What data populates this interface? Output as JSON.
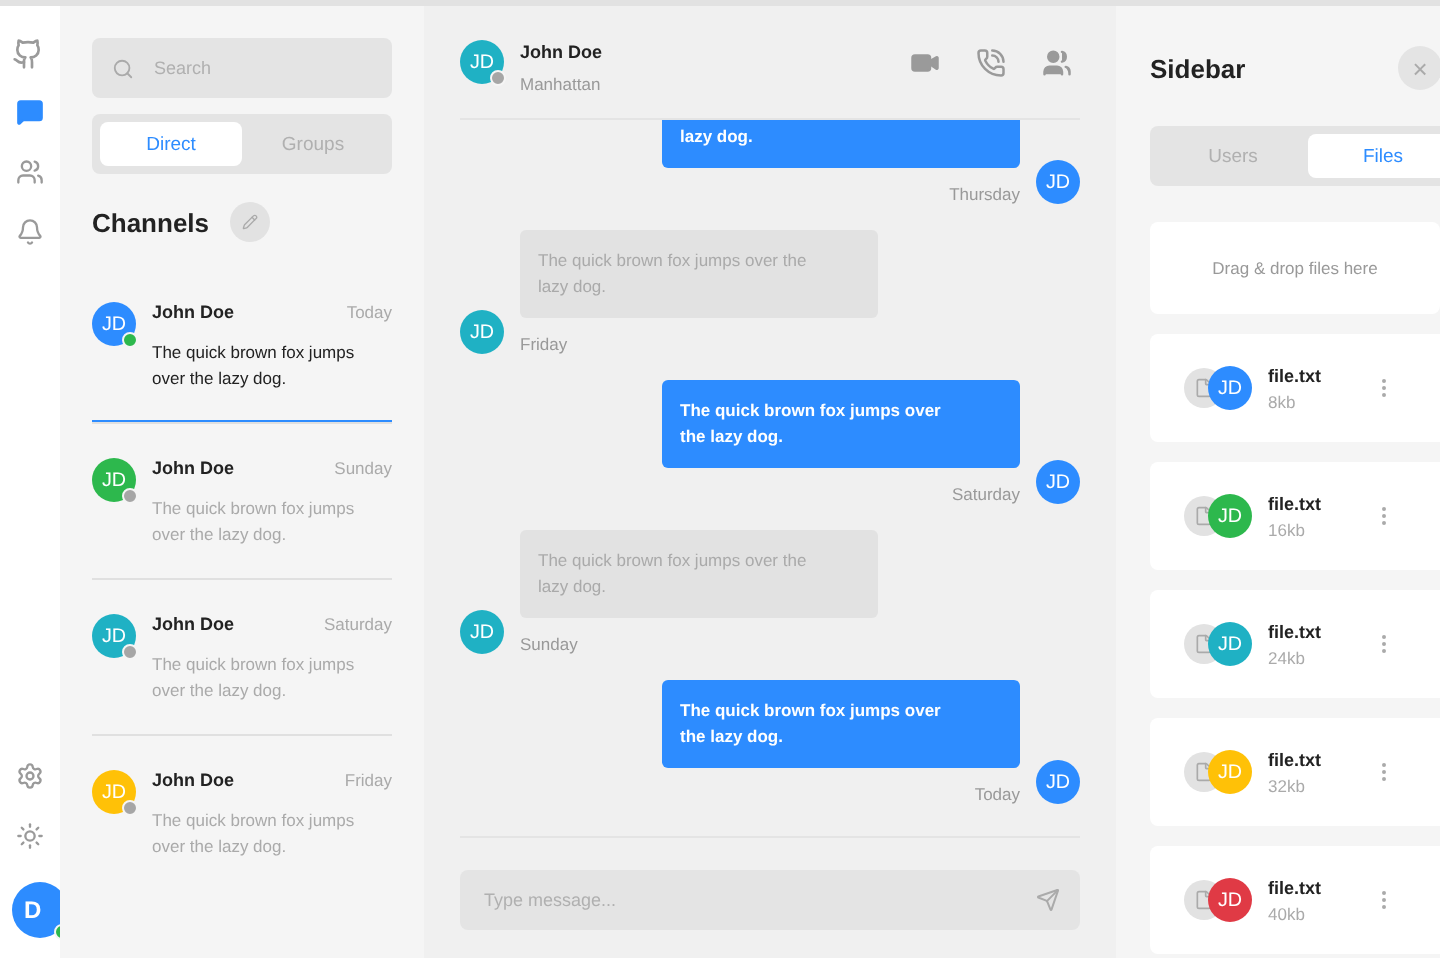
{
  "rail": {
    "avatar": {
      "initials": "D",
      "online": true
    }
  },
  "channels_panel": {
    "search": {
      "placeholder": "Search"
    },
    "tabs": [
      {
        "label": "Direct",
        "selected": true
      },
      {
        "label": "Groups",
        "selected": false
      }
    ],
    "title": "Channels",
    "channels": [
      {
        "initials": "JD",
        "color": "#2d8cff",
        "online": true,
        "name": "John Doe",
        "time": "Today",
        "preview": "The quick brown fox jumps over the lazy dog.",
        "selected": true
      },
      {
        "initials": "JD",
        "color": "#2db84d",
        "online": false,
        "name": "John Doe",
        "time": "Sunday",
        "preview": "The quick brown fox jumps over the lazy dog.",
        "selected": false
      },
      {
        "initials": "JD",
        "color": "#1fb1c4",
        "online": false,
        "name": "John Doe",
        "time": "Saturday",
        "preview": "The quick brown fox jumps over the lazy dog.",
        "selected": false
      },
      {
        "initials": "JD",
        "color": "#ffc107",
        "online": false,
        "name": "John Doe",
        "time": "Friday",
        "preview": "The quick brown fox jumps over the lazy dog.",
        "selected": false
      }
    ]
  },
  "chat": {
    "header": {
      "initials": "JD",
      "color": "#1fb1c4",
      "online": false,
      "name": "John Doe",
      "location": "Manhattan"
    },
    "messages": [
      {
        "outgoing": true,
        "initials": "JD",
        "color": "#2d8cff",
        "text": "lazy dog.",
        "time": "Thursday"
      },
      {
        "outgoing": false,
        "initials": "JD",
        "color": "#1fb1c4",
        "text": "The quick brown fox jumps over the lazy dog.",
        "time": "Friday"
      },
      {
        "outgoing": true,
        "initials": "JD",
        "color": "#2d8cff",
        "text": "The quick brown fox jumps over the lazy dog.",
        "time": "Saturday"
      },
      {
        "outgoing": false,
        "initials": "JD",
        "color": "#1fb1c4",
        "text": "The quick brown fox jumps over the lazy dog.",
        "time": "Sunday"
      },
      {
        "outgoing": true,
        "initials": "JD",
        "color": "#2d8cff",
        "text": "The quick brown fox jumps over the lazy dog.",
        "time": "Today"
      }
    ],
    "composer": {
      "placeholder": "Type message..."
    }
  },
  "sidebar": {
    "title": "Sidebar",
    "close": "×",
    "tabs": [
      {
        "label": "Users",
        "selected": false
      },
      {
        "label": "Files",
        "selected": true
      }
    ],
    "dropzone": "Drag & drop files here",
    "files": [
      {
        "initials": "JD",
        "color": "#2d8cff",
        "name": "file.txt",
        "size": "8kb"
      },
      {
        "initials": "JD",
        "color": "#2db84d",
        "name": "file.txt",
        "size": "16kb"
      },
      {
        "initials": "JD",
        "color": "#1fb1c4",
        "name": "file.txt",
        "size": "24kb"
      },
      {
        "initials": "JD",
        "color": "#ffc107",
        "name": "file.txt",
        "size": "32kb"
      },
      {
        "initials": "JD",
        "color": "#e03a45",
        "name": "file.txt",
        "size": "40kb"
      }
    ]
  }
}
